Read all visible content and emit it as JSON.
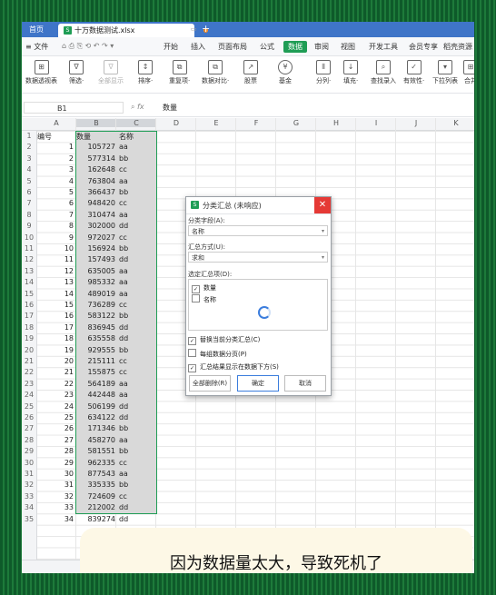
{
  "titlebar": {
    "home": "首页",
    "file": "十万数据测试.xlsx",
    "add": "+"
  },
  "menu": [
    "≡ 文件",
    "开始",
    "插入",
    "页面布局",
    "公式",
    "数据",
    "审阅",
    "视图",
    "开发工具",
    "会员专享",
    "稻壳资源"
  ],
  "ribbon": [
    {
      "label": "数据透视表",
      "icon": "⊞"
    },
    {
      "label": "筛选·",
      "icon": "∇"
    },
    {
      "label": "全部显示",
      "icon": "∇"
    },
    {
      "label": "排序·",
      "icon": "↕"
    },
    {
      "label": "重复项·",
      "icon": "⧉"
    },
    {
      "label": "数据对比·",
      "icon": "⧉"
    },
    {
      "label": "股票",
      "icon": "↗"
    },
    {
      "label": "基金",
      "icon": "¥"
    },
    {
      "label": "分列·",
      "icon": "⫴"
    },
    {
      "label": "填充·",
      "icon": "↓"
    },
    {
      "label": "查找录入",
      "icon": "⌕"
    },
    {
      "label": "有效性·",
      "icon": "✓"
    },
    {
      "label": "下拉列表",
      "icon": "▾"
    },
    {
      "label": "合并",
      "icon": "⊞"
    }
  ],
  "formula": {
    "cell": "B1",
    "fx": "fx",
    "value": "数量"
  },
  "columns": [
    "A",
    "B",
    "C",
    "D",
    "E",
    "F",
    "G",
    "H",
    "I",
    "J",
    "K"
  ],
  "headers": {
    "a": "编号",
    "b": "数量",
    "c": "名称"
  },
  "rows": [
    [
      "1",
      "105727",
      "aa"
    ],
    [
      "2",
      "577314",
      "bb"
    ],
    [
      "3",
      "162648",
      "cc"
    ],
    [
      "4",
      "763804",
      "aa"
    ],
    [
      "5",
      "366437",
      "bb"
    ],
    [
      "6",
      "948420",
      "cc"
    ],
    [
      "7",
      "310474",
      "aa"
    ],
    [
      "8",
      "302000",
      "dd"
    ],
    [
      "9",
      "972027",
      "cc"
    ],
    [
      "10",
      "156924",
      "bb"
    ],
    [
      "11",
      "157493",
      "dd"
    ],
    [
      "12",
      "635005",
      "aa"
    ],
    [
      "13",
      "985332",
      "aa"
    ],
    [
      "14",
      "489019",
      "aa"
    ],
    [
      "15",
      "736289",
      "cc"
    ],
    [
      "16",
      "583122",
      "bb"
    ],
    [
      "17",
      "836945",
      "dd"
    ],
    [
      "18",
      "635558",
      "dd"
    ],
    [
      "19",
      "929555",
      "bb"
    ],
    [
      "20",
      "215111",
      "cc"
    ],
    [
      "21",
      "155875",
      "cc"
    ],
    [
      "22",
      "564189",
      "aa"
    ],
    [
      "23",
      "442448",
      "aa"
    ],
    [
      "24",
      "506199",
      "dd"
    ],
    [
      "25",
      "634122",
      "dd"
    ],
    [
      "26",
      "171346",
      "bb"
    ],
    [
      "27",
      "458270",
      "aa"
    ],
    [
      "28",
      "581551",
      "bb"
    ],
    [
      "29",
      "962335",
      "cc"
    ],
    [
      "30",
      "877543",
      "aa"
    ],
    [
      "31",
      "335335",
      "bb"
    ],
    [
      "32",
      "724609",
      "cc"
    ],
    [
      "33",
      "212002",
      "dd"
    ],
    [
      "34",
      "839274",
      "dd"
    ]
  ],
  "dialog": {
    "title": "分类汇总 (未响应)",
    "field_label": "分类字段(A):",
    "field_value": "名称",
    "method_label": "汇总方式(U):",
    "method_value": "求和",
    "items_label": "选定汇总项(D):",
    "items": [
      {
        "label": "数量",
        "checked": true
      },
      {
        "label": "名称",
        "checked": false
      }
    ],
    "opt_replace": "替换当前分类汇总(C)",
    "opt_page": "每组数据分页(P)",
    "opt_below": "汇总结果显示在数据下方(S)",
    "btn_remove": "全部删除(R)",
    "btn_ok": "确定",
    "btn_cancel": "取消"
  },
  "banner": "因为数据量太大，导致死机了"
}
